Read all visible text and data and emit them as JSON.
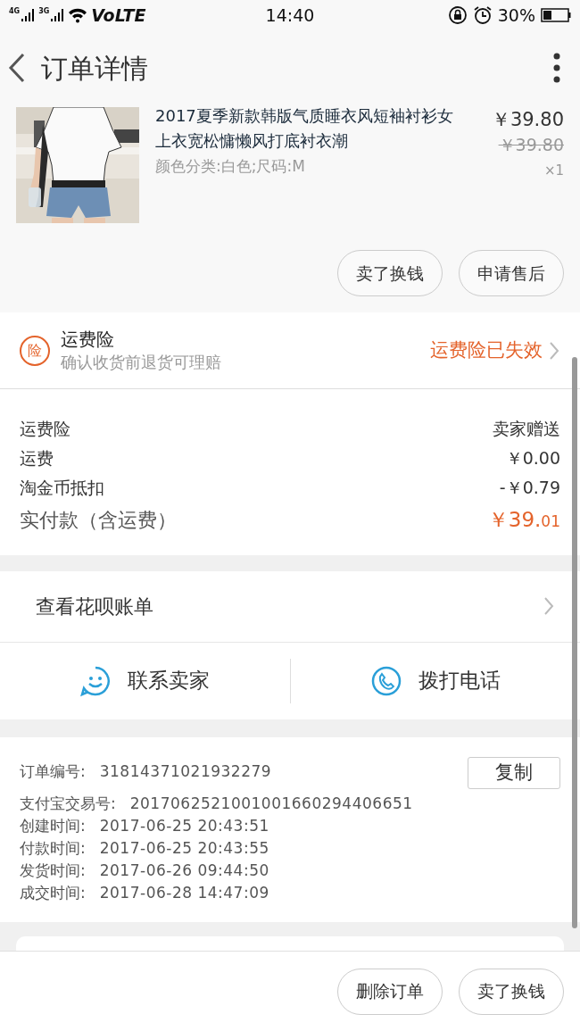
{
  "status_bar": {
    "signal_1": "4G",
    "signal_2": "3G",
    "network": "VoLTE",
    "time": "14:40",
    "battery": "30%"
  },
  "header": {
    "title": "订单详情"
  },
  "product": {
    "title": "2017夏季新款韩版气质睡衣风短袖衬衫女上衣宽松慵懒风打底衬衣潮",
    "spec": "颜色分类:白色;尺码:M",
    "price": "￥39.80",
    "original_price": "￥39.80",
    "quantity": "×1"
  },
  "product_actions": [
    "卖了换钱",
    "申请售后"
  ],
  "insurance": {
    "badge": "险",
    "title": "运费险",
    "subtitle": "确认收货前退货可理赔",
    "status": "运费险已失效"
  },
  "fees": [
    {
      "kind": "normal",
      "label": "运费险",
      "value": "卖家赠送"
    },
    {
      "kind": "normal",
      "label": "运费",
      "value": "￥0.00"
    },
    {
      "kind": "normal",
      "label": "淘金币抵扣",
      "value": "-￥0.79"
    },
    {
      "kind": "total",
      "label": "实付款（含运费）",
      "value": "￥39.",
      "value_fraction": "01"
    }
  ],
  "huabei": {
    "label": "查看花呗账单"
  },
  "contact": [
    {
      "kind": "chat",
      "label": "联系卖家"
    },
    {
      "kind": "phone",
      "label": "拨打电话"
    }
  ],
  "order_info": {
    "copy_button": "复制",
    "rows": [
      {
        "label": "订单编号:",
        "value": "31814371021932279"
      },
      {
        "label": "支付宝交易号:",
        "value": "2017062521001001660294406651"
      },
      {
        "label": "创建时间:",
        "value": "2017-06-25 20:43:51"
      },
      {
        "label": "付款时间:",
        "value": "2017-06-25 20:43:55"
      },
      {
        "label": "发货时间:",
        "value": "2017-06-26 09:44:50"
      },
      {
        "label": "成交时间:",
        "value": "2017-06-28 14:47:09"
      }
    ]
  },
  "bottom_actions": [
    "删除订单",
    "卖了换钱"
  ]
}
